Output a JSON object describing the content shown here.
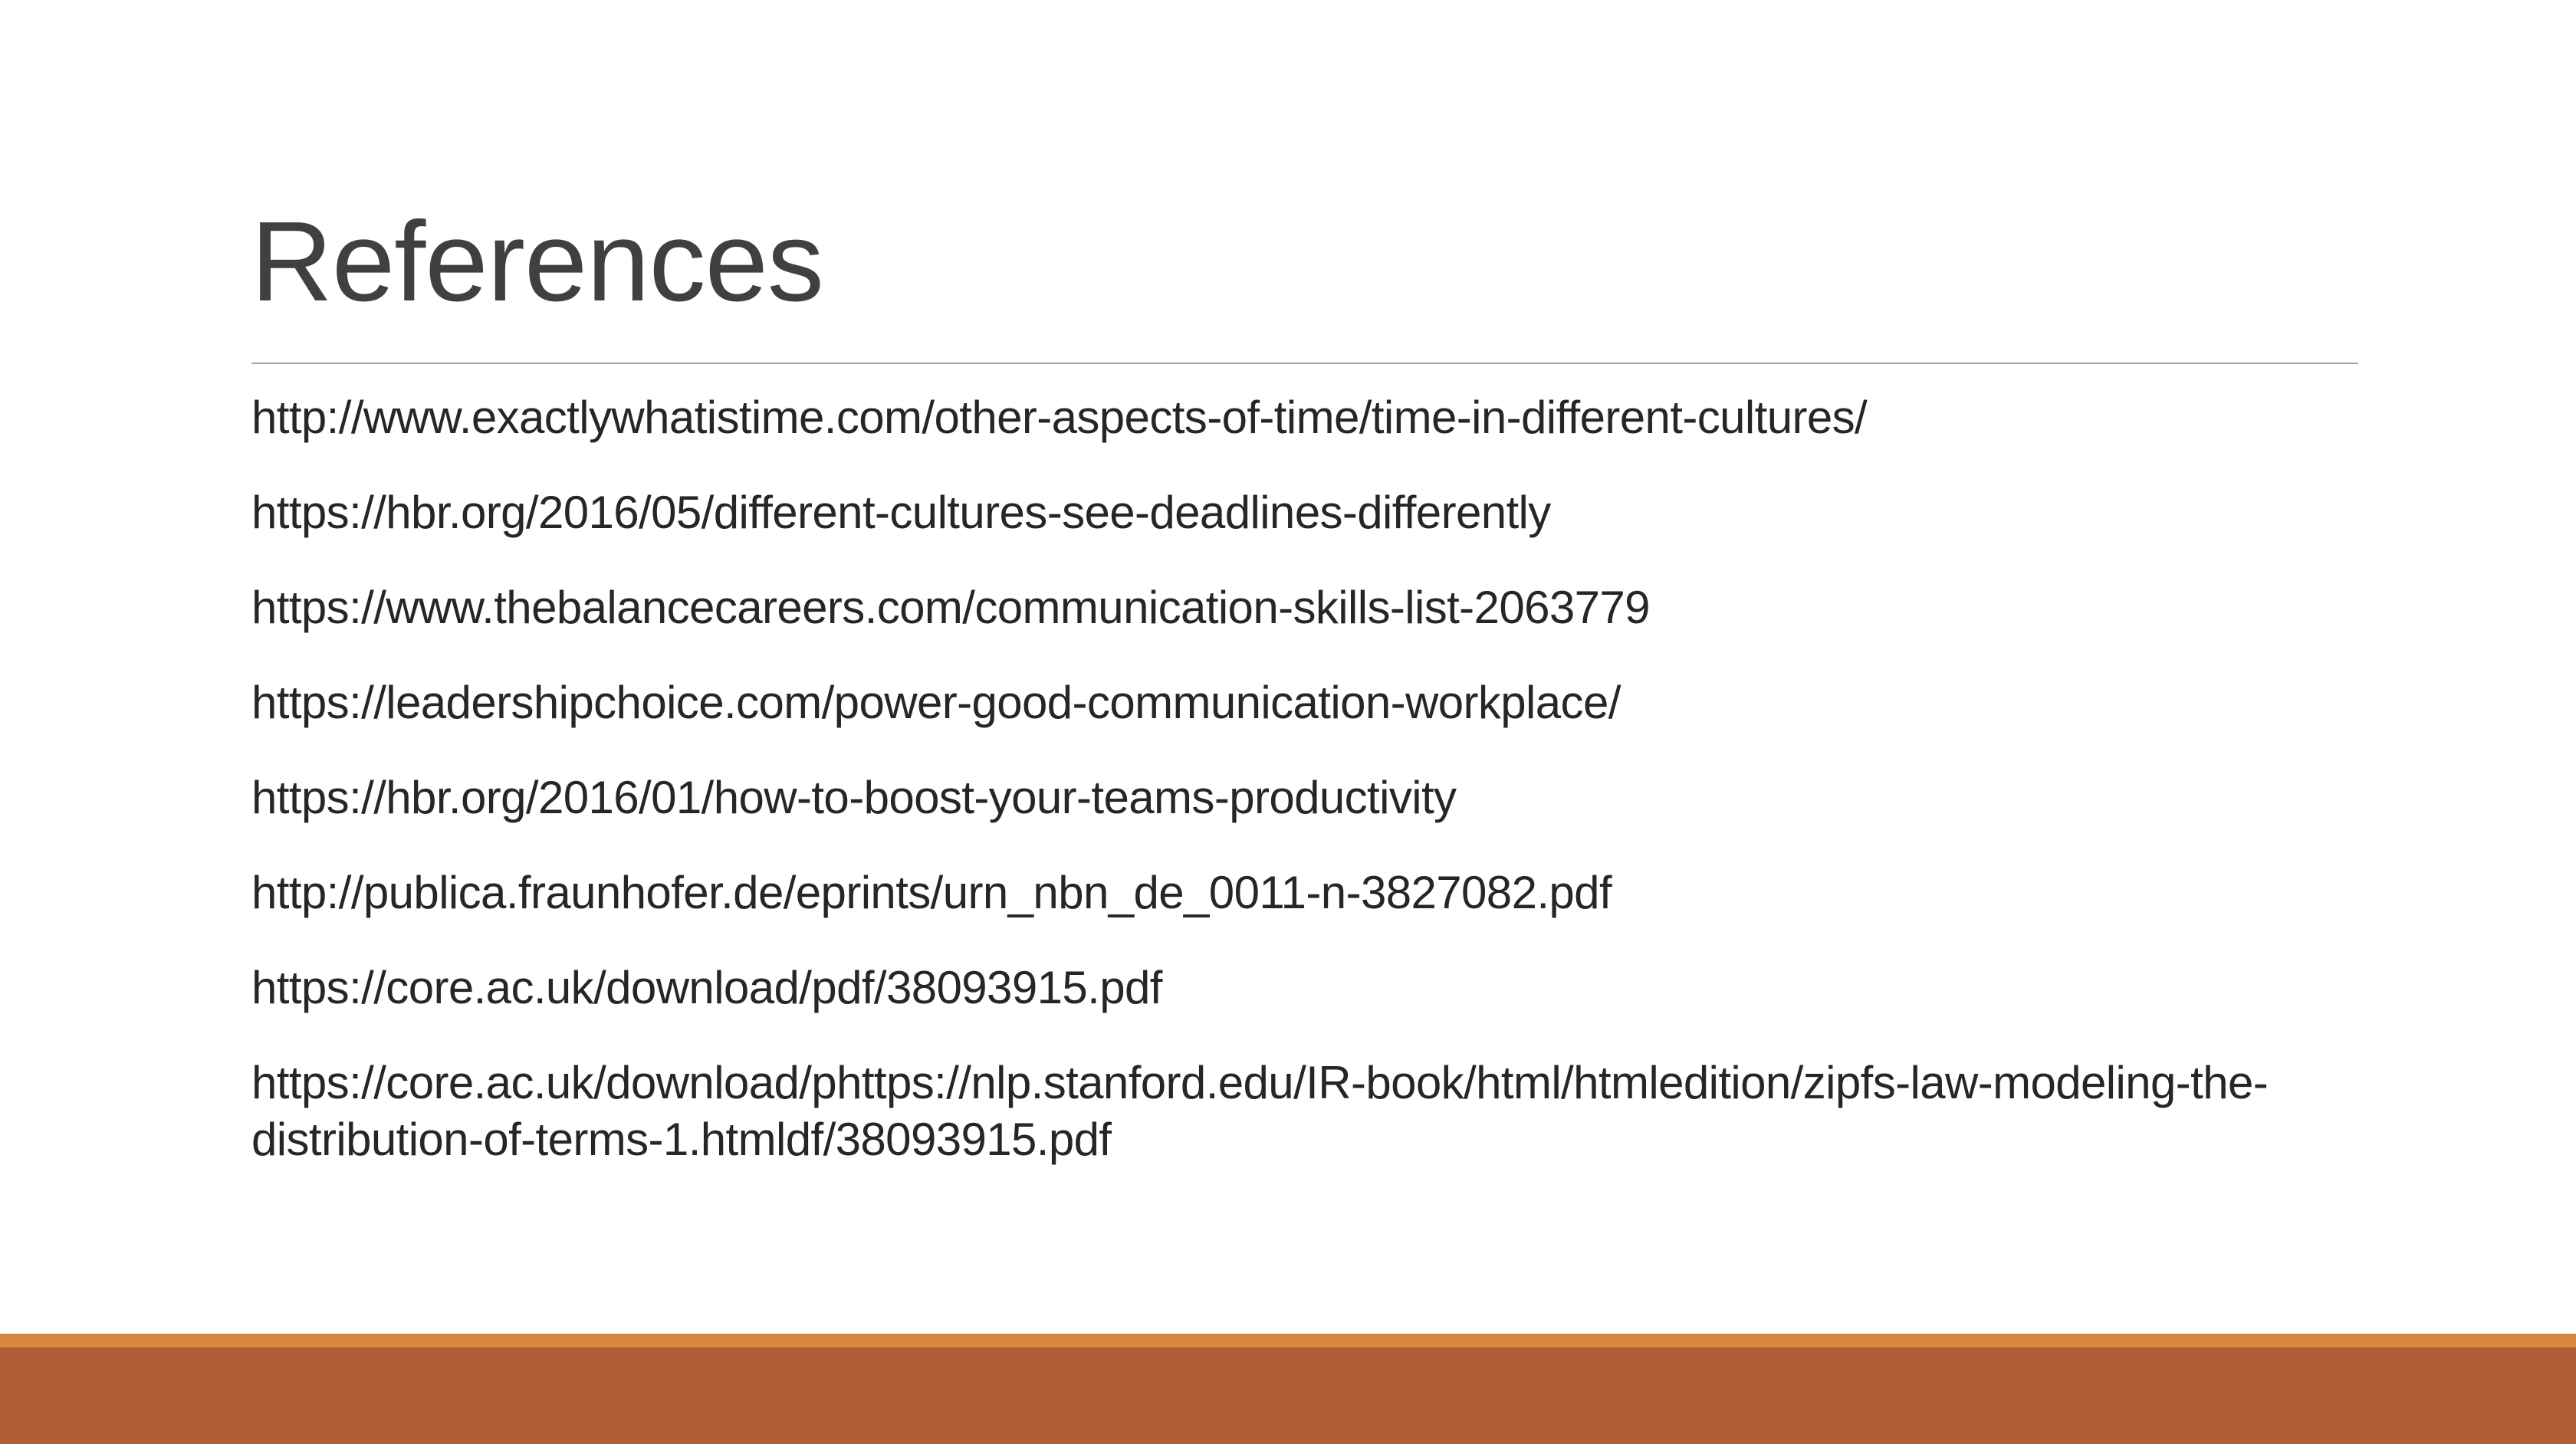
{
  "slide": {
    "title": "References",
    "references": [
      "http://www.exactlywhatistime.com/other-aspects-of-time/time-in-different-cultures/",
      "https://hbr.org/2016/05/different-cultures-see-deadlines-differently",
      "https://www.thebalancecareers.com/communication-skills-list-2063779",
      "https://leadershipchoice.com/power-good-communication-workplace/",
      "https://hbr.org/2016/01/how-to-boost-your-teams-productivity",
      "http://publica.fraunhofer.de/eprints/urn_nbn_de_0011-n-3827082.pdf",
      "https://core.ac.uk/download/pdf/38093915.pdf",
      "https://core.ac.uk/download/phttps://nlp.stanford.edu/IR-book/html/htmledition/zipfs-law-modeling-the-distribution-of-terms-1.htmldf/38093915.pdf"
    ]
  },
  "colors": {
    "title_text": "#404040",
    "body_text": "#262626",
    "rule": "#a6a6a6",
    "footer_accent": "#d7883d",
    "footer_band": "#b05d38"
  }
}
